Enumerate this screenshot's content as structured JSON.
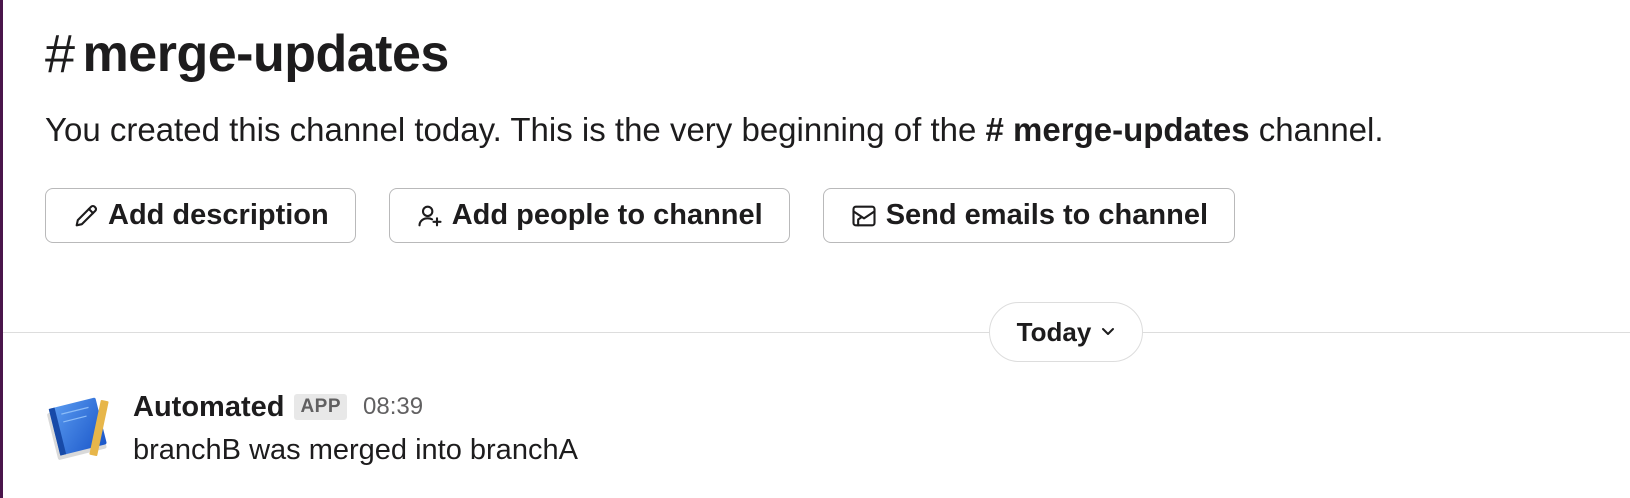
{
  "channel": {
    "hash": "#",
    "name": "merge-updates"
  },
  "intro": {
    "prefix": "You created this channel today. This is the very beginning of the ",
    "channel_hash": "#",
    "channel_name": "merge-updates",
    "suffix": " channel."
  },
  "actions": {
    "add_description": "Add description",
    "add_people": "Add people to channel",
    "send_emails": "Send emails to channel"
  },
  "day_divider": {
    "label": "Today"
  },
  "messages": [
    {
      "sender": "Automated",
      "badge": "APP",
      "time": "08:39",
      "text": "branchB was merged into branchA",
      "avatar_icon": "blue-notebook-icon"
    }
  ],
  "colors": {
    "sidebar_edge": "#4a154b",
    "divider": "#dddddd",
    "button_border": "#b9b9ba",
    "muted_text": "#616061"
  }
}
